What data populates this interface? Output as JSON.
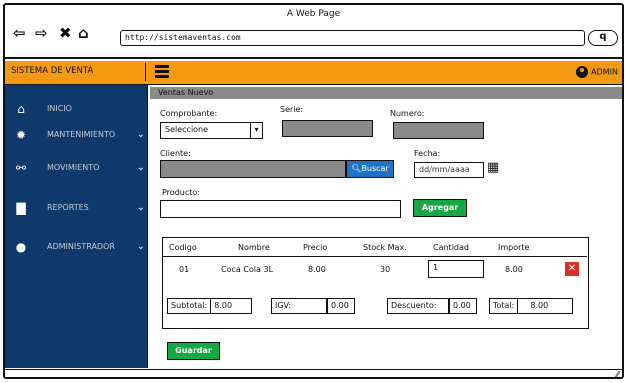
{
  "window": {
    "title": "A Web Page",
    "url": "http://sistemaventas.com"
  },
  "browser_icons": [
    "back-arrow-icon",
    "forward-arrow-icon",
    "close-x-icon",
    "home-icon",
    "search-icon"
  ],
  "topbar": {
    "brand": "SISTEMA DE VENTA",
    "user": "ADMIN"
  },
  "sidebar": {
    "items": [
      {
        "label": "INICIO",
        "icon": "home-icon"
      },
      {
        "label": "MANTENIMIENTO",
        "icon": "gear-icon"
      },
      {
        "label": "MOVIMIENTO",
        "icon": "movement-icon"
      },
      {
        "label": "REPORTES",
        "icon": "document-icon"
      },
      {
        "label": "ADMINISTRADOR",
        "icon": "user-icon"
      }
    ]
  },
  "form": {
    "section": "Ventas Nuevo",
    "comprobante_label": "Comprobante:",
    "comprobante_value": "Seleccione",
    "serie_label": "Serie:",
    "numero_label": "Numero:",
    "cliente_label": "Cliente:",
    "buscar_label": "Buscar",
    "fecha_label": "Fecha:",
    "fecha_placeholder": "dd/mm/aaaa",
    "producto_label": "Producto:",
    "agregar_label": "Agregar",
    "guardar_label": "Guardar"
  },
  "table": {
    "columns": [
      "Codigo",
      "Nombre",
      "Precio",
      "Stock Max.",
      "Cantidad",
      "Importe"
    ],
    "rows": [
      {
        "codigo": "01",
        "nombre": "Coca Cola 3L",
        "precio": "8.00",
        "stock": "30",
        "cantidad": "1",
        "importe": "8.00"
      }
    ]
  },
  "totals": {
    "subtotal_label": "Subtotal:",
    "subtotal": "8.00",
    "igv_label": "IGV:",
    "igv": "0.00",
    "descuento_label": "Descuento:",
    "descuento": "0.00",
    "total_label": "Total:",
    "total": "8.00"
  },
  "colors": {
    "topbar": "#f39a12",
    "sidebar": "#0d3a6b",
    "green": "#17a845",
    "blue": "#1e73c9",
    "red": "#d93025"
  }
}
